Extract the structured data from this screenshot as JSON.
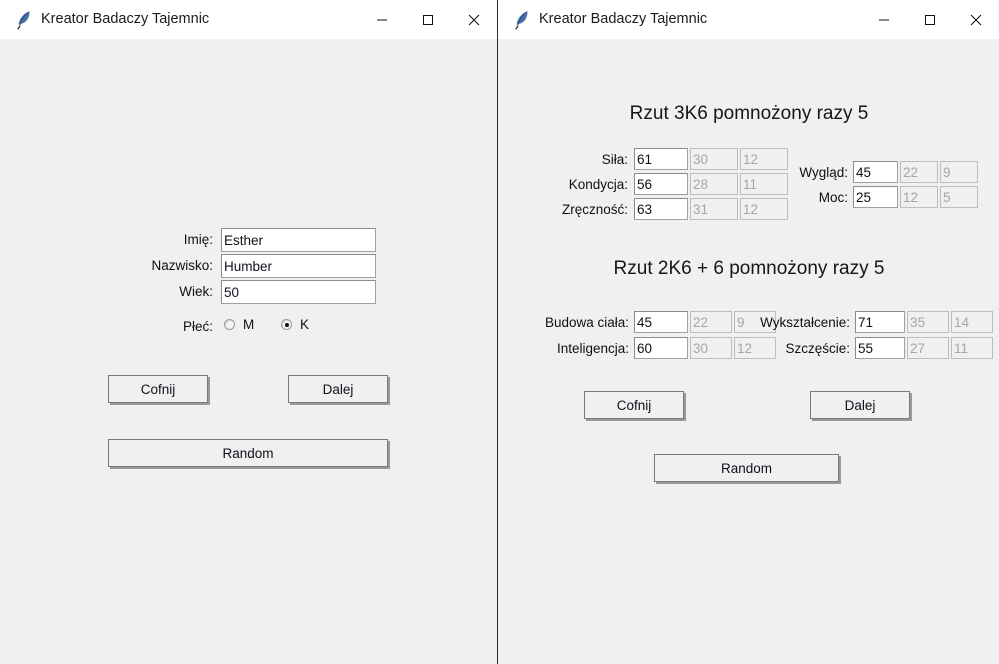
{
  "windows": {
    "left": {
      "title": "Kreator Badaczy Tajemnic",
      "icon": "feather-quill-icon",
      "controls": {
        "minimize": "minimize-icon",
        "maximize": "maximize-icon",
        "close": "close-icon"
      },
      "form": {
        "fields": [
          {
            "label": "Imię:",
            "value": "Esther"
          },
          {
            "label": "Nazwisko:",
            "value": "Humber"
          },
          {
            "label": "Wiek:",
            "value": "50"
          }
        ],
        "gender": {
          "label": "Płeć:",
          "options": [
            {
              "label": "M",
              "selected": false
            },
            {
              "label": "K",
              "selected": true
            }
          ]
        }
      },
      "buttons": {
        "back": "Cofnij",
        "next": "Dalej",
        "random": "Random"
      }
    },
    "right": {
      "title": "Kreator Badaczy Tajemnic",
      "icon": "feather-quill-icon",
      "controls": {
        "minimize": "minimize-icon",
        "maximize": "maximize-icon",
        "close": "close-icon"
      },
      "sections": [
        {
          "title": "Rzut 3K6 pomnożony razy 5",
          "left_stats": [
            {
              "label": "Siła:",
              "value": "61",
              "half": "30",
              "fifth": "12"
            },
            {
              "label": "Kondycja:",
              "value": "56",
              "half": "28",
              "fifth": "11"
            },
            {
              "label": "Zręczność:",
              "value": "63",
              "half": "31",
              "fifth": "12"
            }
          ],
          "right_stats": [
            {
              "label": "Wygląd:",
              "value": "45",
              "half": "22",
              "fifth": "9"
            },
            {
              "label": "Moc:",
              "value": "25",
              "half": "12",
              "fifth": "5"
            }
          ]
        },
        {
          "title": "Rzut 2K6 + 6 pomnożony razy 5",
          "left_stats": [
            {
              "label": "Budowa ciała:",
              "value": "45",
              "half": "22",
              "fifth": "9"
            },
            {
              "label": "Inteligencja:",
              "value": "60",
              "half": "30",
              "fifth": "12"
            }
          ],
          "right_stats": [
            {
              "label": "Wykształcenie:",
              "value": "71",
              "half": "35",
              "fifth": "14"
            },
            {
              "label": "Szczęście:",
              "value": "55",
              "half": "27",
              "fifth": "11"
            }
          ]
        }
      ],
      "buttons": {
        "back": "Cofnij",
        "next": "Dalej",
        "random": "Random"
      }
    }
  },
  "colors": {
    "window_bg": "#f0f0f0",
    "titlebar_bg": "#ffffff",
    "entry_bg": "#ffffff",
    "entry_disabled_text": "#a6a6a6",
    "text": "#10101a",
    "close_hover": "#e81123"
  }
}
